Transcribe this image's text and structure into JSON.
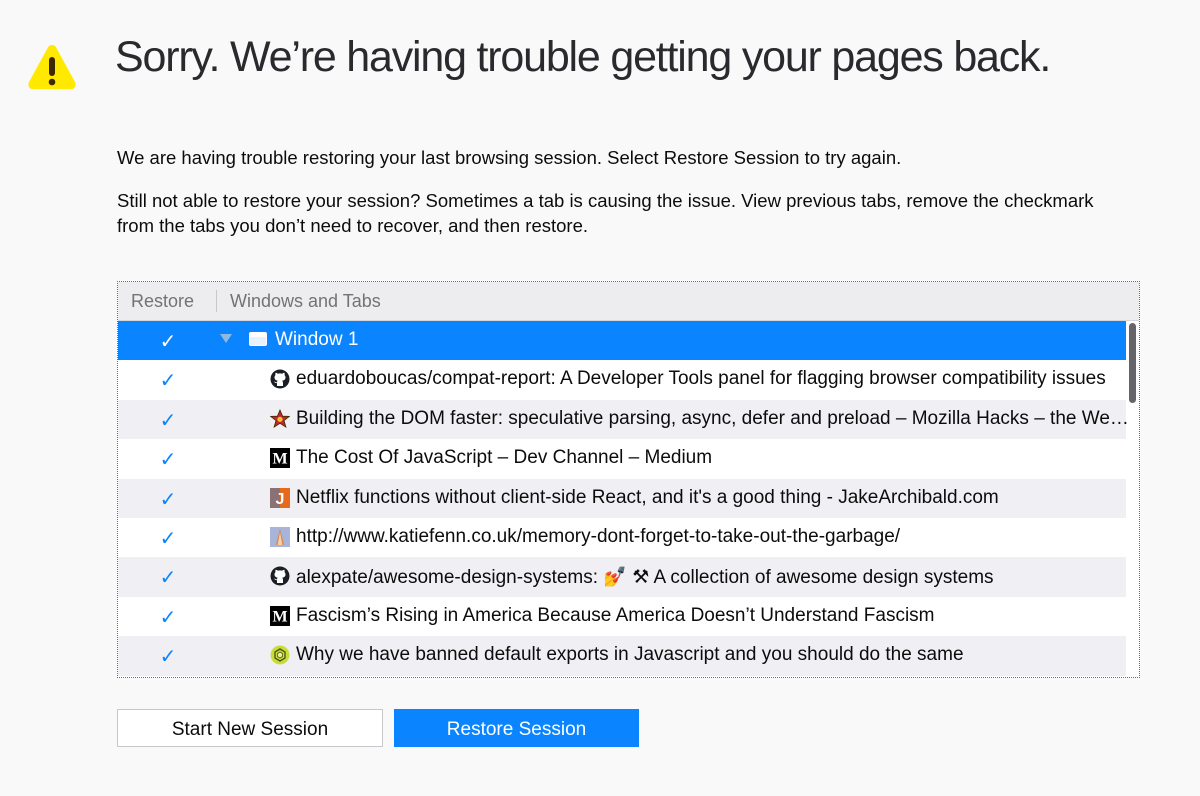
{
  "title": "Sorry. We’re having trouble getting your pages back.",
  "paragraph1": "We are having trouble restoring your last browsing session. Select Restore Session to try again.",
  "paragraph2": "Still not able to restore your session? Sometimes a tab is causing the issue. View previous tabs, remove the checkmark from the tabs you don’t need to recover, and then restore.",
  "tree": {
    "columns": {
      "restore": "Restore",
      "windows_and_tabs": "Windows and Tabs"
    },
    "window": {
      "label": "Window 1",
      "checked": true
    },
    "tabs": [
      {
        "icon": "github-icon",
        "label": "eduardoboucas/compat-report: A Developer Tools panel for flagging browser compatibility issues",
        "checked": true
      },
      {
        "icon": "mozilla-hacks-star-icon",
        "label": "Building the DOM faster: speculative parsing, async, defer and preload – Mozilla Hacks – the Web developer blog",
        "checked": true
      },
      {
        "icon": "medium-icon",
        "label": "The Cost Of JavaScript – Dev Channel – Medium",
        "checked": true
      },
      {
        "icon": "jakearchibald-icon",
        "label": "Netflix functions without client-side React, and it's a good thing - JakeArchibald.com",
        "checked": true
      },
      {
        "icon": "katiefenn-icon",
        "label": "http://www.katiefenn.co.uk/memory-dont-forget-to-take-out-the-garbage/",
        "checked": true
      },
      {
        "icon": "github-icon",
        "label": "alexpate/awesome-design-systems: 💅 ⚒ A collection of awesome design systems",
        "checked": true
      },
      {
        "icon": "medium-icon",
        "label": "Fascism’s Rising in America Because America Doesn’t Understand Fascism",
        "checked": true
      },
      {
        "icon": "hexagon-icon",
        "label": "Why we have banned default exports in Javascript and you should do the same",
        "checked": true
      }
    ],
    "check_glyph": "✓"
  },
  "buttons": {
    "start_new": "Start New Session",
    "restore": "Restore Session"
  },
  "colors": {
    "accent": "#0a84ff",
    "warning": "#ffe900"
  }
}
